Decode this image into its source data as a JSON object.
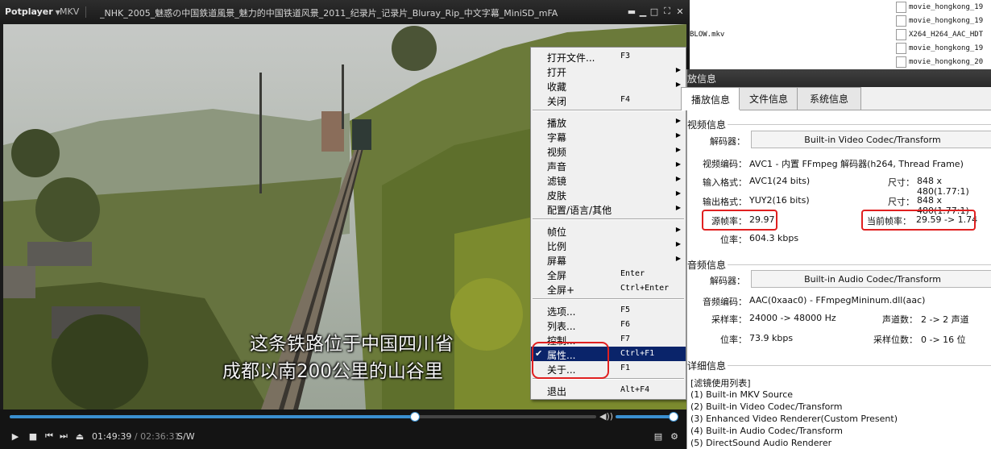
{
  "background_window": {
    "filename": "BLOW.mkv",
    "files": [
      "movie_hongkong_19",
      "movie_hongkong_19",
      "X264_H264_AAC_HDT",
      "movie_hongkong_19",
      "movie_hongkong_20"
    ]
  },
  "player": {
    "brand": "Potplayer",
    "format_label": "MKV",
    "title": "_NHK_2005_魅惑の中国鉄道風景_魅力的中国铁道风景_2011_纪录片_记录片_Bluray_Rip_中文字幕_MiniSD_mFA",
    "subtitles": [
      "这条铁路位于中国四川省",
      "成都以南200公里的山谷里"
    ],
    "time_current": "01:49:39",
    "time_separator": " / ",
    "time_total": "02:36:31",
    "time_mode": "S/W",
    "seek_progress": 0.69,
    "volume": 1.0,
    "accent_color": "#3a8fd0"
  },
  "context_menu": {
    "groups": [
      [
        {
          "label": "打开文件...",
          "shortcut": "F3"
        },
        {
          "label": "打开",
          "submenu": true
        },
        {
          "label": "收藏",
          "submenu": true
        },
        {
          "label": "关闭",
          "shortcut": "F4"
        }
      ],
      [
        {
          "label": "播放",
          "submenu": true
        },
        {
          "label": "字幕",
          "submenu": true
        },
        {
          "label": "视频",
          "submenu": true
        },
        {
          "label": "声音",
          "submenu": true
        },
        {
          "label": "滤镜",
          "submenu": true
        },
        {
          "label": "皮肤",
          "submenu": true
        },
        {
          "label": "配置/语言/其他",
          "submenu": true
        }
      ],
      [
        {
          "label": "帧位",
          "submenu": true
        },
        {
          "label": "比例",
          "submenu": true
        },
        {
          "label": "屏幕",
          "submenu": true
        },
        {
          "label": "全屏",
          "shortcut": "Enter"
        },
        {
          "label": "全屏+",
          "shortcut": "Ctrl+Enter"
        }
      ],
      [
        {
          "label": "选项...",
          "shortcut": "F5"
        },
        {
          "label": "列表...",
          "shortcut": "F6"
        },
        {
          "label": "控制...",
          "shortcut": "F7"
        },
        {
          "label": "属性...",
          "shortcut": "Ctrl+F1",
          "checked": true,
          "selected": true
        },
        {
          "label": "关于...",
          "shortcut": "F1"
        }
      ],
      [
        {
          "label": "退出",
          "shortcut": "Alt+F4"
        }
      ]
    ]
  },
  "properties": {
    "title": "放信息",
    "tabs": [
      "播放信息",
      "文件信息",
      "系统信息"
    ],
    "video_section": "视频信息",
    "video_decoder_label": "解码器：",
    "video_decoder_value": "Built-in Video Codec/Transform",
    "video_codec_label": "视频编码：",
    "video_codec_value": "AVC1 - 内置 FFmpeg 解码器(h264, Thread Frame)",
    "input_format_label": "输入格式：",
    "input_format_value": "AVC1(24 bits)",
    "input_size_label": "尺寸：",
    "input_size_value": "848 x 480(1.77:1)",
    "output_format_label": "输出格式：",
    "output_format_value": "YUY2(16 bits)",
    "output_size_label": "尺寸：",
    "output_size_value": "848 x 480(1.77:1)",
    "source_fps_label": "源帧率：",
    "source_fps_value": "29.97",
    "current_fps_label": "当前帧率：",
    "current_fps_value": "29.59 -> 1.74",
    "video_bitrate_label": "位率：",
    "video_bitrate_value": "604.3 kbps",
    "audio_section": "音频信息",
    "audio_decoder_label": "解码器：",
    "audio_decoder_value": "Built-in Audio Codec/Transform",
    "audio_codec_label": "音频编码：",
    "audio_codec_value": "AAC(0xaac0) - FFmpegMininum.dll(aac)",
    "samplerate_label": "采样率：",
    "samplerate_value": "24000 -> 48000 Hz",
    "channels_label": "声道数：",
    "channels_value": "2 -> 2 声道",
    "audio_bitrate_label": "位率：",
    "audio_bitrate_value": "73.9 kbps",
    "sample_bits_label": "采样位数：",
    "sample_bits_value": "0 -> 16 位",
    "detail_section": "详细信息",
    "filter_header": "[滤镜使用列表]",
    "filters": [
      "(1) Built-in MKV Source",
      "(2) Built-in Video Codec/Transform",
      "(3) Enhanced Video Renderer(Custom Present)",
      "(4) Built-in Audio Codec/Transform",
      "(5) DirectSound Audio Renderer"
    ]
  }
}
